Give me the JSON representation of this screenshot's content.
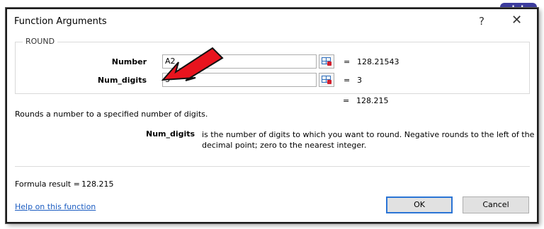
{
  "window": {
    "title": "Function Arguments",
    "help_glyph": "?",
    "close_glyph": "✕"
  },
  "brand": {
    "label": "alphr",
    "color": "#3d3d9e"
  },
  "group": {
    "label": "ROUND"
  },
  "args": [
    {
      "label": "Number",
      "value": "A2",
      "result": "128.21543"
    },
    {
      "label": "Num_digits",
      "value": "3",
      "result": "3"
    }
  ],
  "equals_sign": "=",
  "function_result": "128.215",
  "description": "Rounds a number to a specified number of digits.",
  "param_help": {
    "name": "Num_digits",
    "text": "is the number of digits to which you want to round. Negative rounds to the left of the decimal point; zero to the nearest integer."
  },
  "formula": {
    "label": "Formula result =",
    "value": "128.215"
  },
  "help_link": "Help on this function",
  "buttons": {
    "ok": "OK",
    "cancel": "Cancel"
  },
  "annotation": {
    "arrow_color": "#e8141e"
  }
}
